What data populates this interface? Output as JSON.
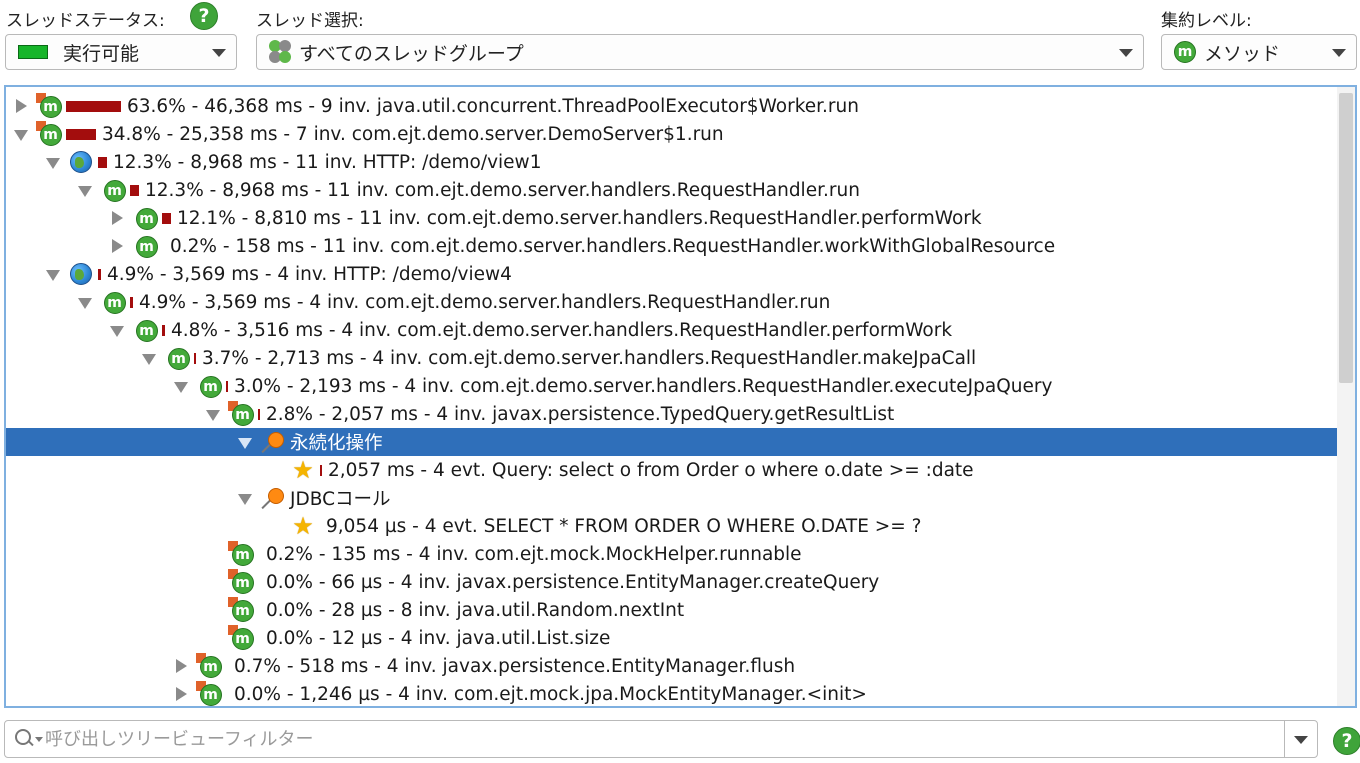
{
  "toolbar": {
    "thread_status_label": "スレッドステータス:",
    "thread_status_value": "実行可能",
    "thread_select_label": "スレッド選択:",
    "thread_select_value": "すべてのスレッドグループ",
    "aggregation_label": "集約レベル:",
    "aggregation_value": "メソッド",
    "help_glyph": "?",
    "m_glyph": "m"
  },
  "tree": {
    "rows": [
      {
        "text": "63.6% - 46,368 ms - 9 inv. java.util.concurrent.ThreadPoolExecutor$Worker.run"
      },
      {
        "text": "34.8% - 25,358 ms - 7 inv. com.ejt.demo.server.DemoServer$1.run"
      },
      {
        "text": "12.3% - 8,968 ms - 11 inv. HTTP: /demo/view1"
      },
      {
        "text": "12.3% - 8,968 ms - 11 inv. com.ejt.demo.server.handlers.RequestHandler.run"
      },
      {
        "text": "12.1% - 8,810 ms - 11 inv. com.ejt.demo.server.handlers.RequestHandler.performWork"
      },
      {
        "text": "0.2% - 158 ms - 11 inv. com.ejt.demo.server.handlers.RequestHandler.workWithGlobalResource"
      },
      {
        "text": "4.9% - 3,569 ms - 4 inv. HTTP: /demo/view4"
      },
      {
        "text": "4.9% - 3,569 ms - 4 inv. com.ejt.demo.server.handlers.RequestHandler.run"
      },
      {
        "text": "4.8% - 3,516 ms - 4 inv. com.ejt.demo.server.handlers.RequestHandler.performWork"
      },
      {
        "text": "3.7% - 2,713 ms - 4 inv. com.ejt.demo.server.handlers.RequestHandler.makeJpaCall"
      },
      {
        "text": "3.0% - 2,193 ms - 4 inv. com.ejt.demo.server.handlers.RequestHandler.executeJpaQuery"
      },
      {
        "text": "2.8% - 2,057 ms - 4 inv. javax.persistence.TypedQuery.getResultList"
      },
      {
        "text": "永続化操作"
      },
      {
        "text": "2,057 ms - 4 evt. Query: select o from Order o where o.date >= :date"
      },
      {
        "text": "JDBCコール"
      },
      {
        "text": "9,054 µs - 4 evt. SELECT * FROM ORDER O WHERE O.DATE >= ?"
      },
      {
        "text": "0.2% - 135 ms - 4 inv. com.ejt.mock.MockHelper.runnable"
      },
      {
        "text": "0.0% - 66 µs - 4 inv. javax.persistence.EntityManager.createQuery"
      },
      {
        "text": "0.0% - 28 µs - 8 inv. java.util.Random.nextInt"
      },
      {
        "text": "0.0% - 12 µs - 4 inv. java.util.List.size"
      },
      {
        "text": "0.7% - 518 ms - 4 inv. javax.persistence.EntityManager.flush"
      },
      {
        "text": "0.0% - 1,246 µs - 4 inv. com.ejt.mock.jpa.MockEntityManager.<init>"
      }
    ]
  },
  "filter": {
    "placeholder": "呼び出しツリービューフィルター"
  }
}
